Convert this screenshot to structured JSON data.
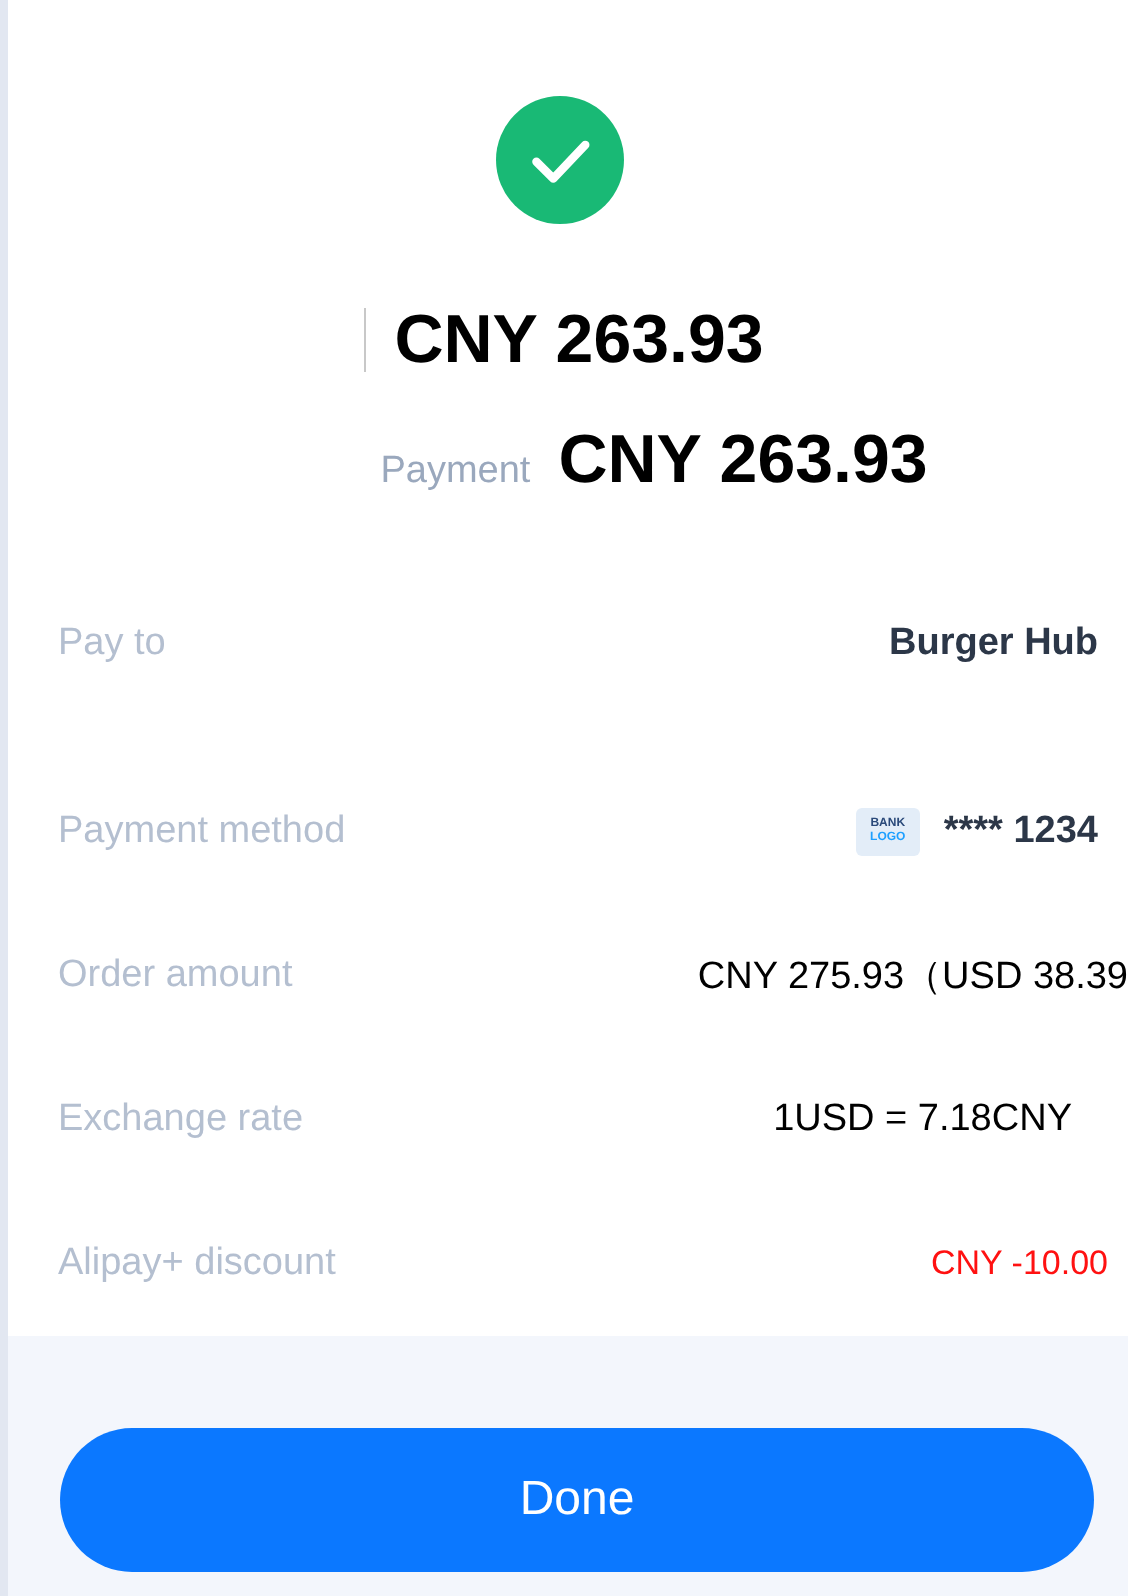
{
  "status": {
    "kind": "success"
  },
  "amount": "CNY 263.93",
  "payment": {
    "label": "Payment",
    "amount": "CNY 263.93"
  },
  "details": [
    {
      "label": "Pay to",
      "kind": "merchant",
      "value": "Burger Hub"
    },
    {
      "label": "Payment method",
      "kind": "card",
      "logo_top": "BANK",
      "logo_bottom": "LOGO",
      "value": "**** 1234"
    },
    {
      "label": "Order amount",
      "kind": "plain",
      "value": "CNY 275.93（USD 38.39"
    },
    {
      "label": "Exchange rate",
      "kind": "rate",
      "value": "1USD = 7.18CNY"
    },
    {
      "label": "Alipay+ discount",
      "kind": "discount",
      "value": "CNY -10.00"
    }
  ],
  "done_button": "Done"
}
